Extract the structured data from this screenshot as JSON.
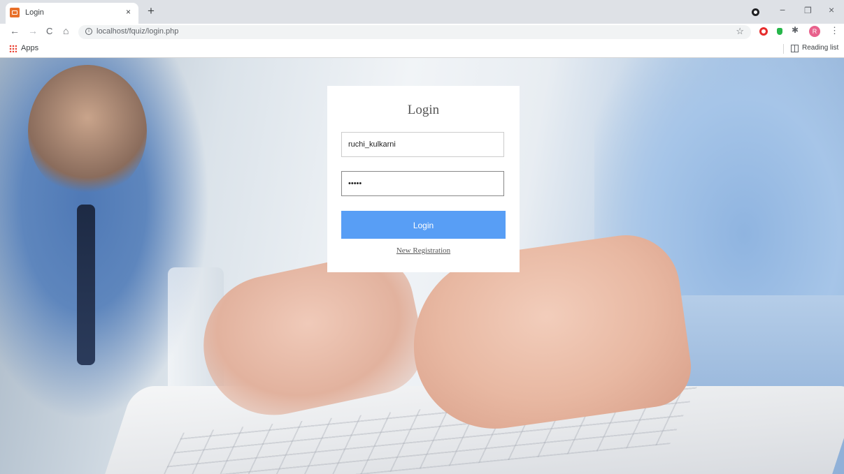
{
  "browser": {
    "tab": {
      "title": "Login",
      "close": "×"
    },
    "new_tab": "+",
    "window_controls": {
      "minimize": "−",
      "restore": "❐",
      "close": "×"
    },
    "nav": {
      "back": "←",
      "forward": "→",
      "reload": "C",
      "home": "⌂"
    },
    "address_bar": {
      "url": "localhost/fquiz/login.php",
      "info": "i",
      "star": "☆"
    },
    "extensions": {
      "puzzle": "✱",
      "profile_initial": "R",
      "menu": "⋮"
    },
    "bookmarks": {
      "apps_label": "Apps",
      "reading_list_label": "Reading list"
    }
  },
  "login_form": {
    "title": "Login",
    "username_value": "ruchi_kulkarni",
    "password_value": "•••••",
    "submit_label": "Login",
    "registration_link": "New Registration"
  },
  "colors": {
    "button": "#589ef5",
    "opera": "#e62c2c",
    "shield": "#26b64a",
    "profile": "#e8618c"
  }
}
